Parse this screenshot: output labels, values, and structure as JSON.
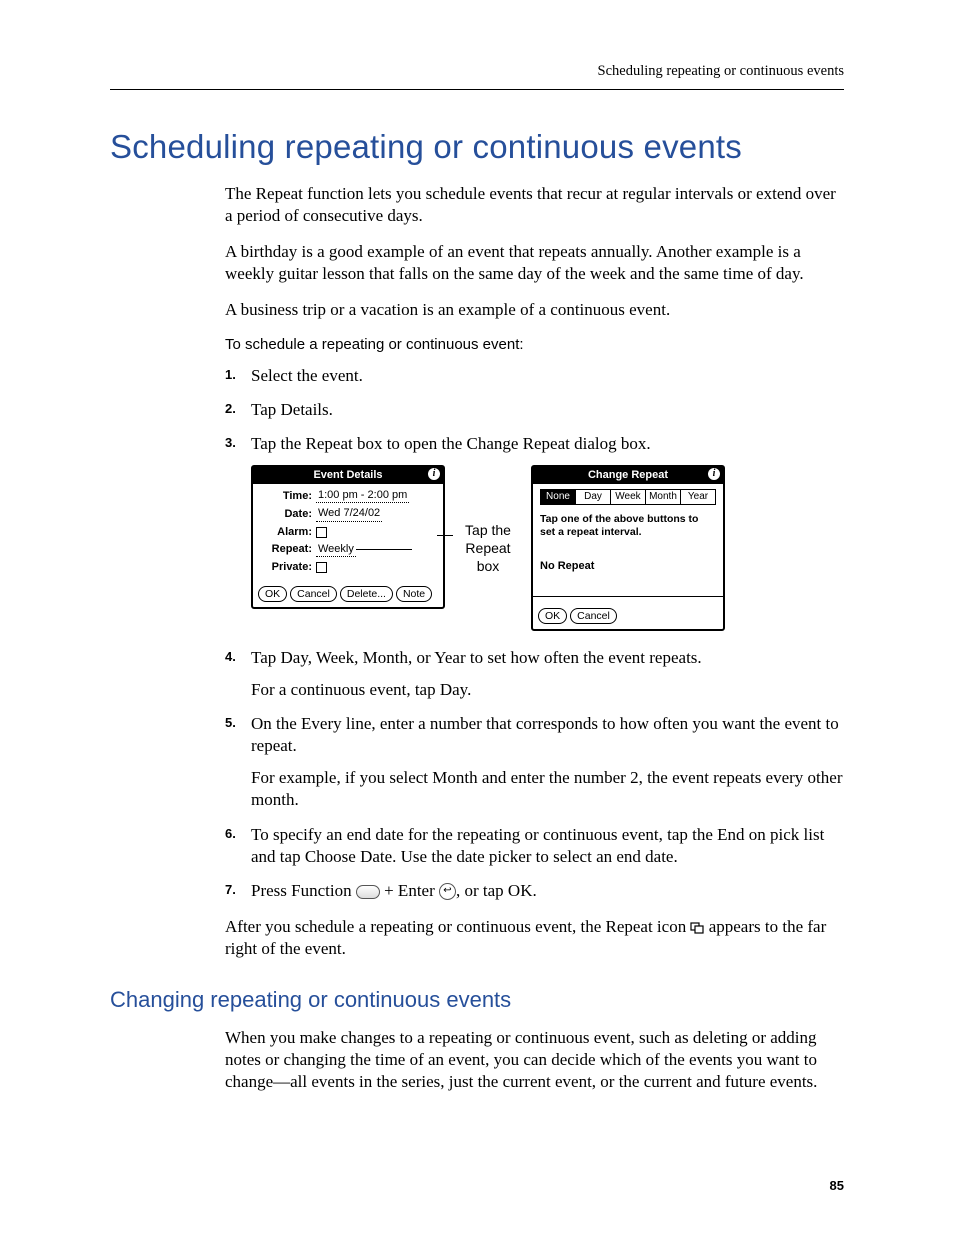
{
  "runningHead": "Scheduling repeating or continuous events",
  "title": "Scheduling repeating or continuous events",
  "intro": [
    "The Repeat function lets you schedule events that recur at regular intervals or extend over a period of consecutive days.",
    "A birthday is a good example of an event that repeats annually. Another example is a weekly guitar lesson that falls on the same day of the week and the same time of day.",
    "A business trip or a vacation is an example of a continuous event."
  ],
  "procHead": "To schedule a repeating or continuous event:",
  "steps": {
    "s1": "Select the event.",
    "s2": "Tap Details.",
    "s3": "Tap the Repeat box to open the Change Repeat dialog box.",
    "s4": "Tap Day, Week, Month, or Year to set how often the event repeats.",
    "s4b": "For a continuous event, tap Day.",
    "s5": "On the Every line, enter a number that corresponds to how often you want the event to repeat.",
    "s5b": "For example, if you select Month and enter the number 2, the event repeats every other month.",
    "s6": "To specify an end date for the repeating or continuous event, tap the End on pick list and tap Choose Date. Use the date picker to select an end date.",
    "s7a": "Press Function ",
    "s7b": " + Enter ",
    "s7c": ", or tap OK."
  },
  "afterA": "After you schedule a repeating or continuous event, the Repeat icon ",
  "afterB": " appears to the far right of the event.",
  "subTitle": "Changing repeating or continuous events",
  "subBody": "When you make changes to a repeating or continuous event, such as deleting or adding notes or changing the time of an event, you can decide which of the events you want to change—all events in the series, just the current event, or the current and future events.",
  "pageNum": "85",
  "dlg1": {
    "title": "Event Details",
    "time_l": "Time:",
    "time_v": "1:00 pm - 2:00 pm",
    "date_l": "Date:",
    "date_v": "Wed 7/24/02",
    "alarm_l": "Alarm:",
    "repeat_l": "Repeat:",
    "repeat_v": "Weekly",
    "private_l": "Private:",
    "ok": "OK",
    "cancel": "Cancel",
    "delete": "Delete...",
    "note": "Note"
  },
  "midLabel": "Tap the Repeat box",
  "dlg2": {
    "title": "Change Repeat",
    "tabs": [
      "None",
      "Day",
      "Week",
      "Month",
      "Year"
    ],
    "msg": "Tap one of the above buttons to set a repeat interval.",
    "noRepeat": "No Repeat",
    "ok": "OK",
    "cancel": "Cancel"
  }
}
